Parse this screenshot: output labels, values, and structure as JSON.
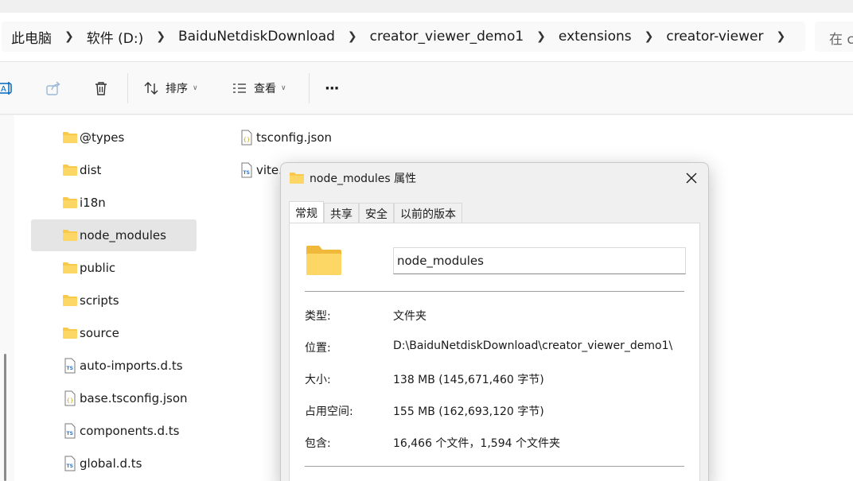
{
  "address": {
    "crumbs": [
      "此电脑",
      "软件 (D:)",
      "BaiduNetdiskDownload",
      "creator_viewer_demo1",
      "extensions",
      "creator-viewer"
    ],
    "search_placeholder": "在 c"
  },
  "toolbar": {
    "sort_label": "排序",
    "view_label": "查看",
    "more_label": "···"
  },
  "tree": {
    "items": [
      {
        "label": "@types",
        "icon": "folder-icon"
      },
      {
        "label": "dist",
        "icon": "folder-icon"
      },
      {
        "label": "i18n",
        "icon": "folder-icon"
      },
      {
        "label": "node_modules",
        "icon": "folder-icon",
        "selected": true
      },
      {
        "label": "public",
        "icon": "folder-icon"
      },
      {
        "label": "scripts",
        "icon": "folder-icon"
      },
      {
        "label": "source",
        "icon": "folder-icon"
      },
      {
        "label": "auto-imports.d.ts",
        "icon": "ts-file-icon"
      },
      {
        "label": "base.tsconfig.json",
        "icon": "json-file-icon"
      },
      {
        "label": "components.d.ts",
        "icon": "ts-file-icon"
      },
      {
        "label": "global.d.ts",
        "icon": "ts-file-icon"
      }
    ]
  },
  "files": {
    "items": [
      {
        "label": "tsconfig.json",
        "icon": "json-file-icon"
      },
      {
        "label": "vite.",
        "icon": "ts-file-icon"
      }
    ]
  },
  "dialog": {
    "title": "node_modules 属性",
    "tabs": [
      "常规",
      "共享",
      "安全",
      "以前的版本"
    ],
    "name_value": "node_modules",
    "props": [
      {
        "key": "类型:",
        "value": "文件夹"
      },
      {
        "key": "位置:",
        "value": "D:\\BaiduNetdiskDownload\\creator_viewer_demo1\\"
      },
      {
        "key": "大小:",
        "value": "138 MB (145,671,460 字节)"
      },
      {
        "key": "占用空间:",
        "value": "155 MB (162,693,120 字节)"
      },
      {
        "key": "包含:",
        "value": "16,466 个文件，1,594 个文件夹"
      }
    ]
  },
  "colors": {
    "folder": "#f8c94a",
    "selected_bg": "#e5e5e5",
    "accent": "#0067c0"
  }
}
